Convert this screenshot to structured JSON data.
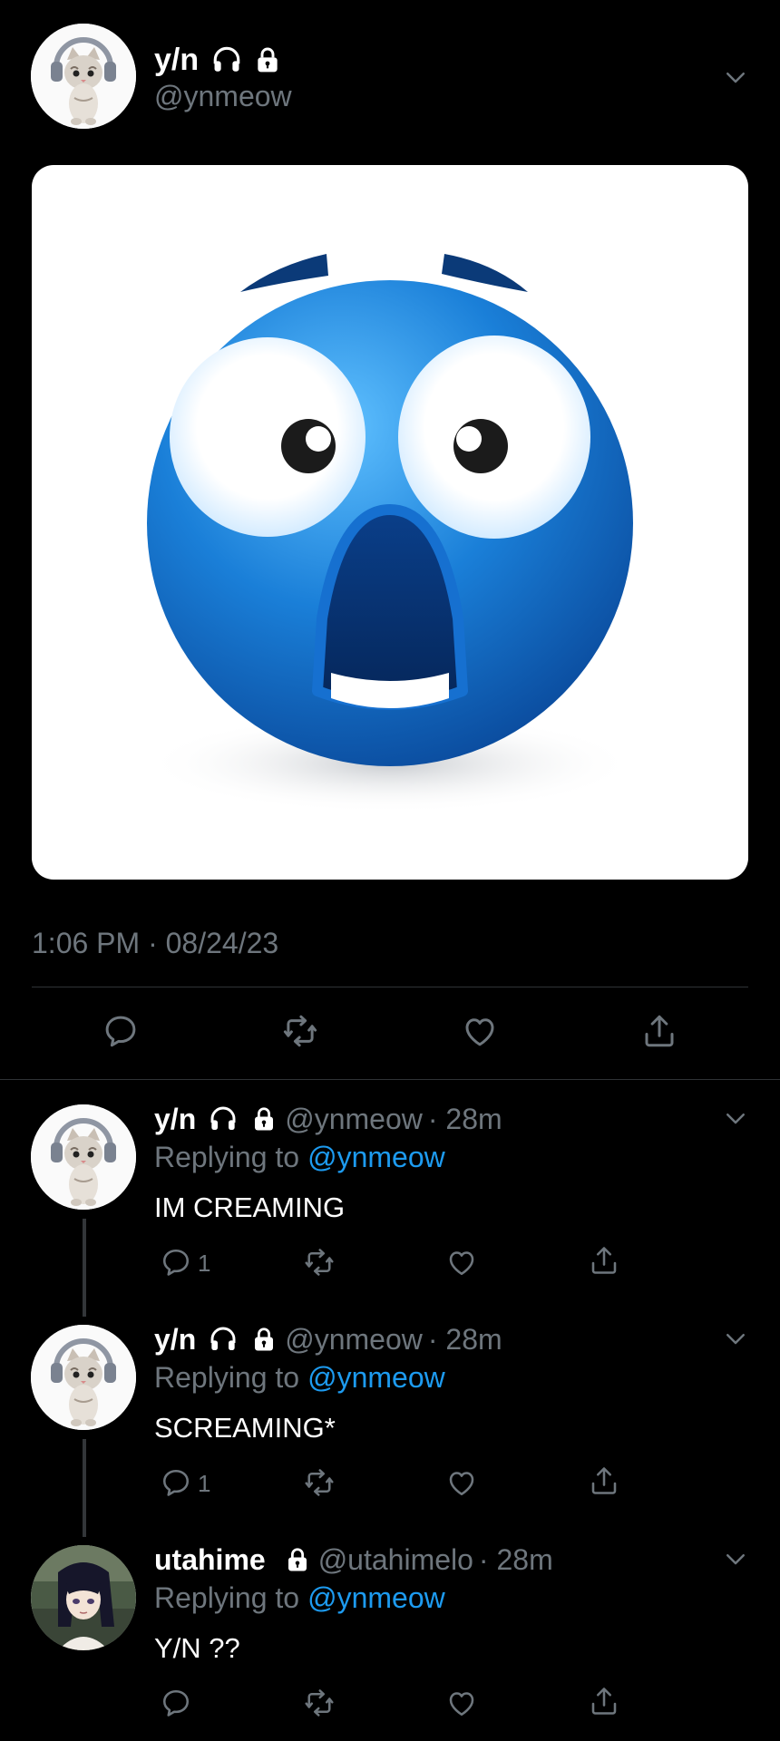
{
  "main_tweet": {
    "display_name": "y/n",
    "handle": "@ynmeow",
    "timestamp": "1:06 PM · 08/24/23",
    "media_icon": "shocked-blue-emoji"
  },
  "replies": [
    {
      "display_name": "y/n",
      "handle": "@ynmeow",
      "time": "· 28m",
      "replying_prefix": "Replying to",
      "replying_to": "@ynmeow",
      "text": "IM CREAMING",
      "reply_count": "1"
    },
    {
      "display_name": "y/n",
      "handle": "@ynmeow",
      "time": "· 28m",
      "replying_prefix": "Replying to",
      "replying_to": "@ynmeow",
      "text": "SCREAMING*",
      "reply_count": "1"
    },
    {
      "display_name": "utahime",
      "handle": "@utahimelo",
      "time": "· 28m",
      "replying_prefix": "Replying to",
      "replying_to": "@ynmeow",
      "text": "Y/N ??",
      "reply_count": ""
    }
  ],
  "colors": {
    "background": "#000000",
    "secondary_text": "#6e767d",
    "link": "#1d9bf0",
    "divider": "#2f3336"
  }
}
